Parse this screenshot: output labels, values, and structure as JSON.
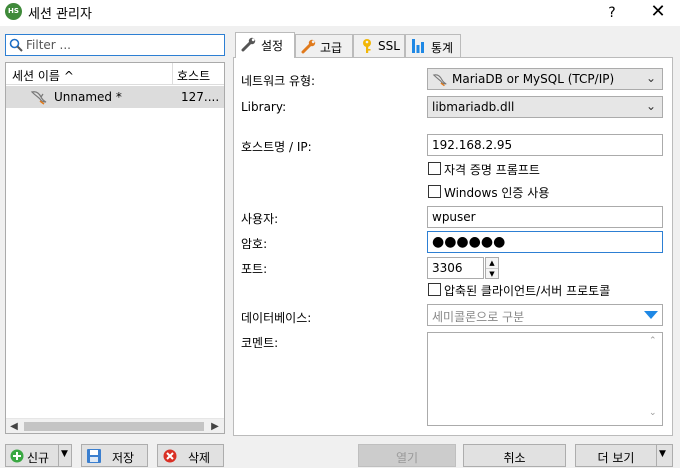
{
  "window": {
    "title": "세션 관리자",
    "app_icon": "HS",
    "help_label": "?",
    "close_label": "✕"
  },
  "filter": {
    "placeholder": "Filter ..."
  },
  "sessions": {
    "columns": [
      "세션 이름",
      "호스트"
    ],
    "sort_indicator": "^",
    "rows": [
      {
        "name": "Unnamed *",
        "host": "127...."
      }
    ]
  },
  "tabs": [
    {
      "label": "설정",
      "icon": "wrench-icon",
      "active": true
    },
    {
      "label": "고급",
      "icon": "wrench-orange-icon",
      "active": false
    },
    {
      "label": "SSL",
      "icon": "key-icon",
      "active": false
    },
    {
      "label": "통계",
      "icon": "bar-chart-icon",
      "active": false
    }
  ],
  "settings": {
    "network_type_label": "네트워크 유형:",
    "network_type_value": "MariaDB or MySQL (TCP/IP)",
    "library_label": "Library:",
    "library_value": "libmariadb.dll",
    "host_label": "호스트명 / IP:",
    "host_value": "192.168.2.95",
    "credential_prompt_label": "자격 증명 프롬프트",
    "windows_auth_label": "Windows 인증 사용",
    "user_label": "사용자:",
    "user_value": "wpuser",
    "password_label": "암호:",
    "password_value": "●●●●●●",
    "port_label": "포트:",
    "port_value": "3306",
    "compression_label": "압축된 클라이언트/서버 프로토콜",
    "database_label": "데이터베이스:",
    "database_placeholder": "세미콜론으로 구분",
    "comment_label": "코멘트:"
  },
  "buttons": {
    "new": "신규",
    "save": "저장",
    "delete": "삭제",
    "open": "열기",
    "cancel": "취소",
    "more": "더 보기"
  },
  "colors": {
    "accent": "#2d7fd3",
    "selected_row": "#dcdcdc",
    "database_dropdown_arrow": "#1e88e5"
  }
}
